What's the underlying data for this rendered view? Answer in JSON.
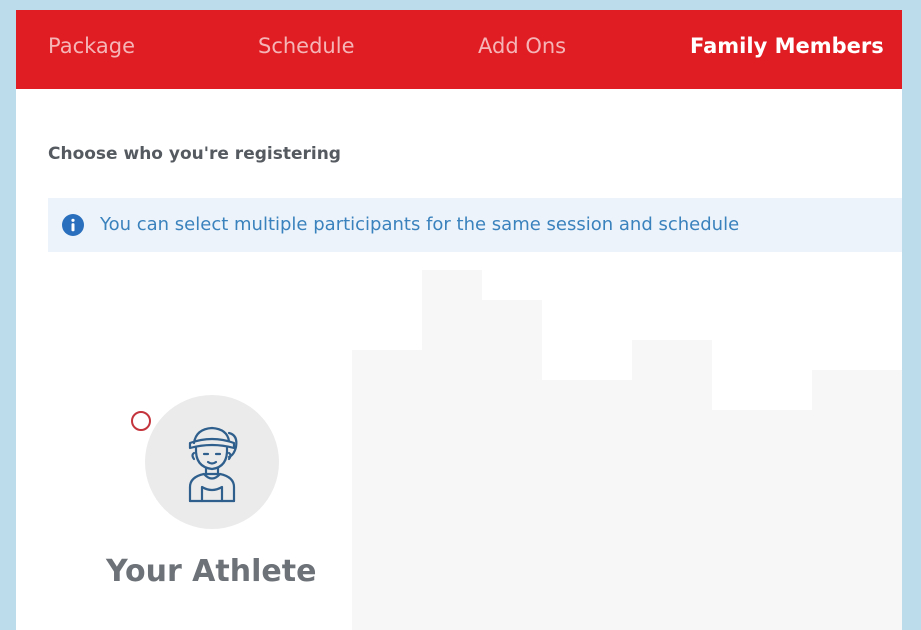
{
  "tabs": [
    {
      "label": "Package",
      "active": false
    },
    {
      "label": "Schedule",
      "active": false
    },
    {
      "label": "Add Ons",
      "active": false
    },
    {
      "label": "Family Members",
      "active": true
    }
  ],
  "main": {
    "heading": "Choose who you're registering",
    "notice": {
      "icon": "info-icon",
      "text": "You can select multiple participants for the same session and schedule"
    },
    "participants": [
      {
        "label": "Your Athlete",
        "selected": false,
        "icon": "athlete-avatar-icon"
      }
    ]
  },
  "colors": {
    "brand_red": "#e01d23",
    "page_background": "#bcdcec",
    "notice_background": "#ecf3fa",
    "notice_text": "#3a82bd",
    "radio_border": "#c4343c",
    "avatar_stroke": "#2f5f8c"
  }
}
